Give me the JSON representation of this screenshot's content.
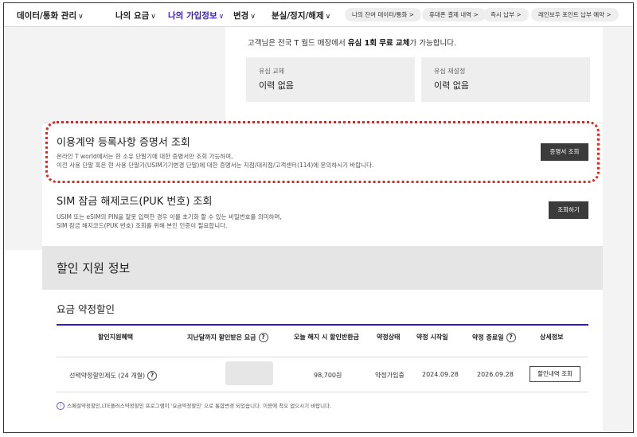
{
  "nav": {
    "items": [
      {
        "label": "데이터/통화 관리",
        "active": false
      },
      {
        "label": "나의 요금",
        "active": false
      },
      {
        "label": "나의 가입정보",
        "active": true
      },
      {
        "label": "변경",
        "active": false
      },
      {
        "label": "분실/정지/해제",
        "active": false
      }
    ],
    "chevron": "∨",
    "quick_links": [
      "나의 잔여 데이터/통화 >",
      "휴대폰 결제 내역 >",
      "즉시 납부 >",
      "레인보우 포인트 납부 예약 >"
    ]
  },
  "usim": {
    "notice_prefix": "고객님은 전국 T 월드 매장에서 ",
    "notice_bold": "유심 1회 무료 교체",
    "notice_suffix": "가 가능합니다.",
    "boxes": [
      {
        "label": "유심 교체",
        "value": "이력 없음"
      },
      {
        "label": "유심 재설정",
        "value": "이력 없음"
      }
    ]
  },
  "certificate": {
    "title": "이용계약 등록사항 증명서 조회",
    "desc_line1": "온라인 T world에서는 현 소유 단말기에 대한 증명서만 조회 가능하며,",
    "desc_line2": "이전 사용 단말 혹은 현 사용 단말기(USIM기기변경 단말)에 대한 증명서는 지점/대리점/고객센터(114)에 문의하시기 바랍니다.",
    "button": "증명서 조회"
  },
  "puk": {
    "title": "SIM 잠금 해제코드(PUK 번호) 조회",
    "desc_line1": "USIM 또는 eSIM의 PIN을 잘못 입력한 경우 이를 초기화 할 수 있는 비밀번호를 의미하며,",
    "desc_line2": "SIM 잠금 해지코드(PUK 번호) 조회를 위해 본인 인증이 필요합니다.",
    "button": "조회하기"
  },
  "discount": {
    "band_title": "할인 지원 정보",
    "sub_title": "요금 약정할인",
    "headers": [
      "할인지원혜택",
      "지난달까지 할인받은 요금",
      "오늘 해지 시 할인반환금",
      "약정상태",
      "약정 시작일",
      "약정 종료일",
      "상세정보"
    ],
    "help": "?",
    "row": {
      "benefit": "선택약정할인제도 (24 개월)",
      "refund": "98,700원",
      "status": "약정가입중",
      "start": "2024.09.28",
      "end": "2026.09.28",
      "button": "할인내역 조회"
    },
    "footnote_icon": "i",
    "footnote": "스페셜약정할인,LTE플러스약정할인 프로그램이 '요금약정할인' 으로 통합변경 되었습니다. 이용에 착오 없으시기 바랍니다."
  }
}
